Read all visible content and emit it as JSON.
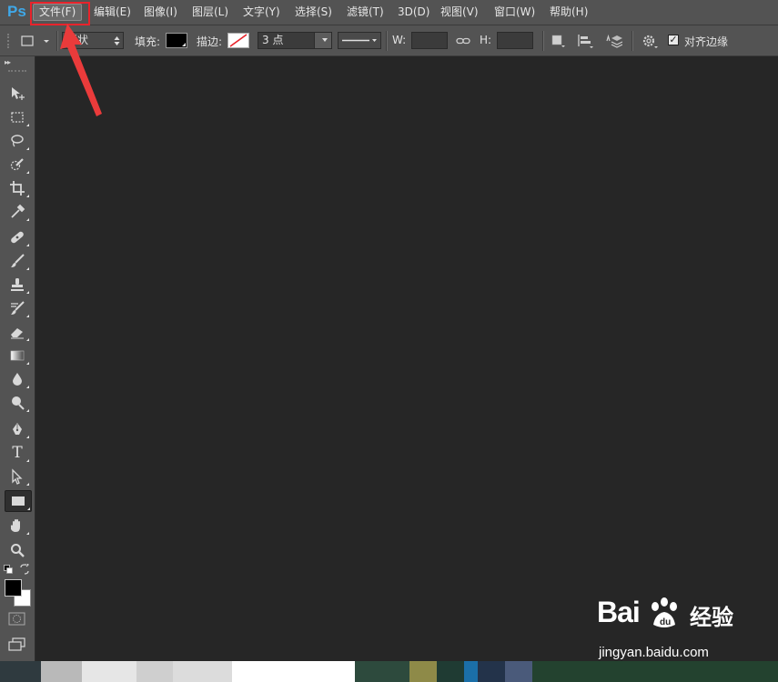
{
  "app": {
    "logo_text": "Ps",
    "accent_color": "#3fa8e8"
  },
  "menu": {
    "items": [
      {
        "label": "文件(F)",
        "active": true
      },
      {
        "label": "编辑(E)"
      },
      {
        "label": "图像(I)"
      },
      {
        "label": "图层(L)"
      },
      {
        "label": "文字(Y)"
      },
      {
        "label": "选择(S)"
      },
      {
        "label": "滤镜(T)"
      },
      {
        "label": "3D(D)"
      },
      {
        "label": "视图(V)"
      },
      {
        "label": "窗口(W)"
      },
      {
        "label": "帮助(H)"
      }
    ],
    "highlight_color": "#e8232b"
  },
  "options": {
    "tool_mode_value": "形状",
    "fill_label": "填充:",
    "fill_color": "#000000",
    "stroke_label": "描边:",
    "stroke_width_value": "3 点",
    "width_label": "W:",
    "width_value": "",
    "height_label": "H:",
    "height_value": "",
    "align_edges_label": "对齐边缘",
    "align_edges_checked": true
  },
  "toolbox": {
    "tools": [
      "move-tool",
      "rectangular-marquee-tool",
      "lasso-tool",
      "quick-selection-tool",
      "crop-tool",
      "eyedropper-tool",
      "spot-healing-brush-tool",
      "brush-tool",
      "clone-stamp-tool",
      "history-brush-tool",
      "eraser-tool",
      "gradient-tool",
      "blur-tool",
      "dodge-tool",
      "pen-tool",
      "type-tool",
      "path-selection-tool",
      "rectangle-tool",
      "hand-tool",
      "zoom-tool"
    ],
    "active_tool": "rectangle-tool",
    "type_tool_glyph": "T",
    "foreground_color": "#000000",
    "background_color": "#ffffff"
  },
  "watermark": {
    "logo_text": "Bai",
    "logo_text_2": "du",
    "brand": "经验",
    "url": "jingyan.baidu.com"
  }
}
